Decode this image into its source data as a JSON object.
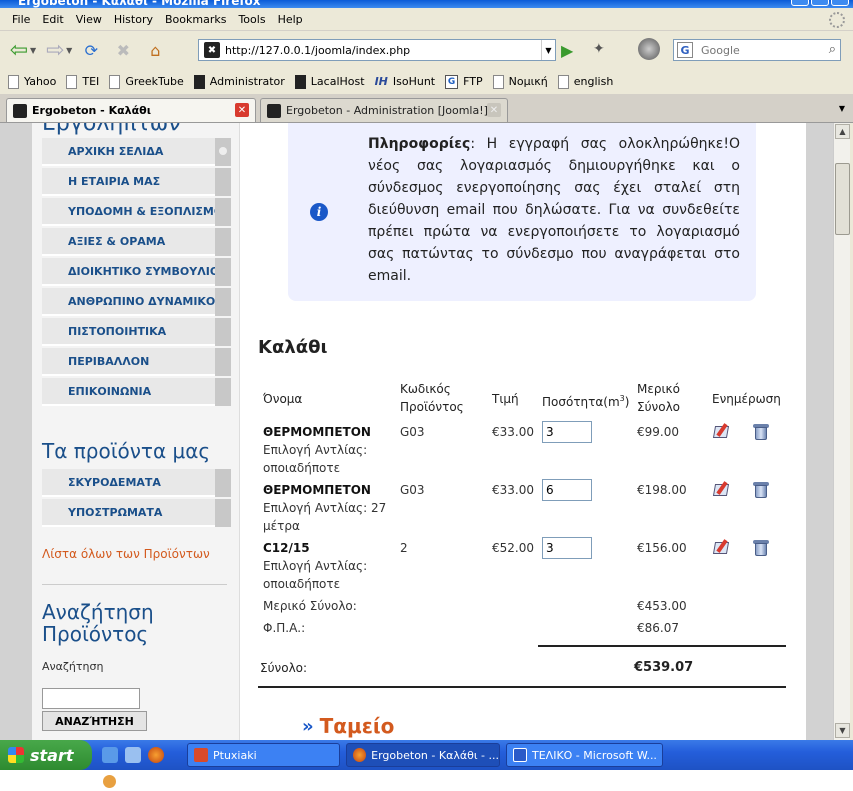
{
  "window": {
    "title": "Ergobeton - Καλάθι - Mozilla Firefox"
  },
  "menu": [
    "File",
    "Edit",
    "View",
    "History",
    "Bookmarks",
    "Tools",
    "Help"
  ],
  "nav": {
    "url": "http://127.0.0.1/joomla/index.php",
    "search_placeholder": "Google"
  },
  "bookmarks": [
    "Yahoo",
    "TEI",
    "GreekTube",
    "Administrator",
    "LacalHost",
    "IsoHunt",
    "FTP",
    "Νομική",
    "english"
  ],
  "tabs": [
    {
      "label": "Ergobeton - Καλάθι"
    },
    {
      "label": "Ergobeton - Administration [Joomla!]"
    }
  ],
  "sidebar": {
    "cut_heading": "Εργοληπτών",
    "menu": [
      "ΑΡΧΙΚΗ ΣΕΛΙΔΑ",
      "Η ΕΤΑΙΡΙΑ ΜΑΣ",
      "ΥΠΟΔΟΜΗ & ΕΞΟΠΛΙΣΜΟΣ",
      "ΑΞΙΕΣ & ΟΡΑΜΑ",
      "ΔΙΟΙΚΗΤΙΚΟ ΣΥΜΒΟΥΛΙΟ",
      "ΑΝΘΡΩΠΙΝΟ ΔΥΝΑΜΙΚΟ",
      "ΠΙΣΤΟΠΟΙΗΤΙΚΑ",
      "ΠΕΡΙΒΑΛΛΟΝ",
      "ΕΠΙΚΟΙΝΩΝΙΑ"
    ],
    "products_title": "Τα προϊόντα μας",
    "products": [
      "ΣΚΥΡΟΔΕΜΑΤΑ",
      "ΥΠΟΣΤΡΩΜΑΤΑ"
    ],
    "all_products_link": "Λίστα όλων των Προϊόντων",
    "search_title_1": "Αναζήτηση",
    "search_title_2": "Προϊόντος",
    "search_label": "Αναζήτηση",
    "search_button": "ΑΝΑΖΉΤΗΣΗ"
  },
  "info": {
    "label": "Πληροφορίες",
    "message": ": Η εγγραφή σας ολοκληρώθηκε!Ο νέος σας λογαριασμός δημιουργήθηκε και ο σύνδεσμος ενεργοποίησης σας έχει σταλεί στη διεύθυνση email που δηλώσατε. Για να συνδεθείτε πρέπει πρώτα να ενεργοποιήσετε το λογαριασμό σας πατώντας το σύνδεσμο που αναγράφεται στο email."
  },
  "cart": {
    "title": "Καλάθι",
    "headers": {
      "name": "Όνομα",
      "code_1": "Κωδικός",
      "code_2": "Προϊόντος",
      "price": "Τιμή",
      "qty": "Ποσότητα(m",
      "qty_sup": "3",
      "qty_end": ")",
      "subtotal_1": "Μερικό",
      "subtotal_2": "Σύνολο",
      "update": "Ενημέρωση"
    },
    "rows": [
      {
        "name": "ΘΕΡΜΟΜΠΕΤΟΝ",
        "opt1": "Επιλογή Αντλίας:",
        "opt2": "οποιαδήποτε",
        "code": "G03",
        "price": "€33.00",
        "qty": "3",
        "subtotal": "€99.00"
      },
      {
        "name": "ΘΕΡΜΟΜΠΕΤΟΝ",
        "opt1": "Επιλογή Αντλίας: 27",
        "opt2": "μέτρα",
        "code": "G03",
        "price": "€33.00",
        "qty": "6",
        "subtotal": "€198.00"
      },
      {
        "name": "C12/15",
        "opt1": "Επιλογή Αντλίας:",
        "opt2": "οποιαδήποτε",
        "code": "2",
        "price": "€52.00",
        "qty": "3",
        "subtotal": "€156.00"
      }
    ],
    "partial_label": "Μερικό Σύνολο:",
    "partial_value": "€453.00",
    "vat_label": "Φ.Π.Α.:",
    "vat_value": "€86.07",
    "total_label": "Σύνολο:",
    "total_value": "€539.07",
    "checkout_arrows": "»",
    "checkout_label": "Ταμείο"
  },
  "taskbar": {
    "start": "start",
    "tasks": [
      "Ptuxiaki",
      "Ergobeton - Καλάθι - ...",
      "ΤΕΛΙΚΟ - Microsoft W..."
    ]
  }
}
